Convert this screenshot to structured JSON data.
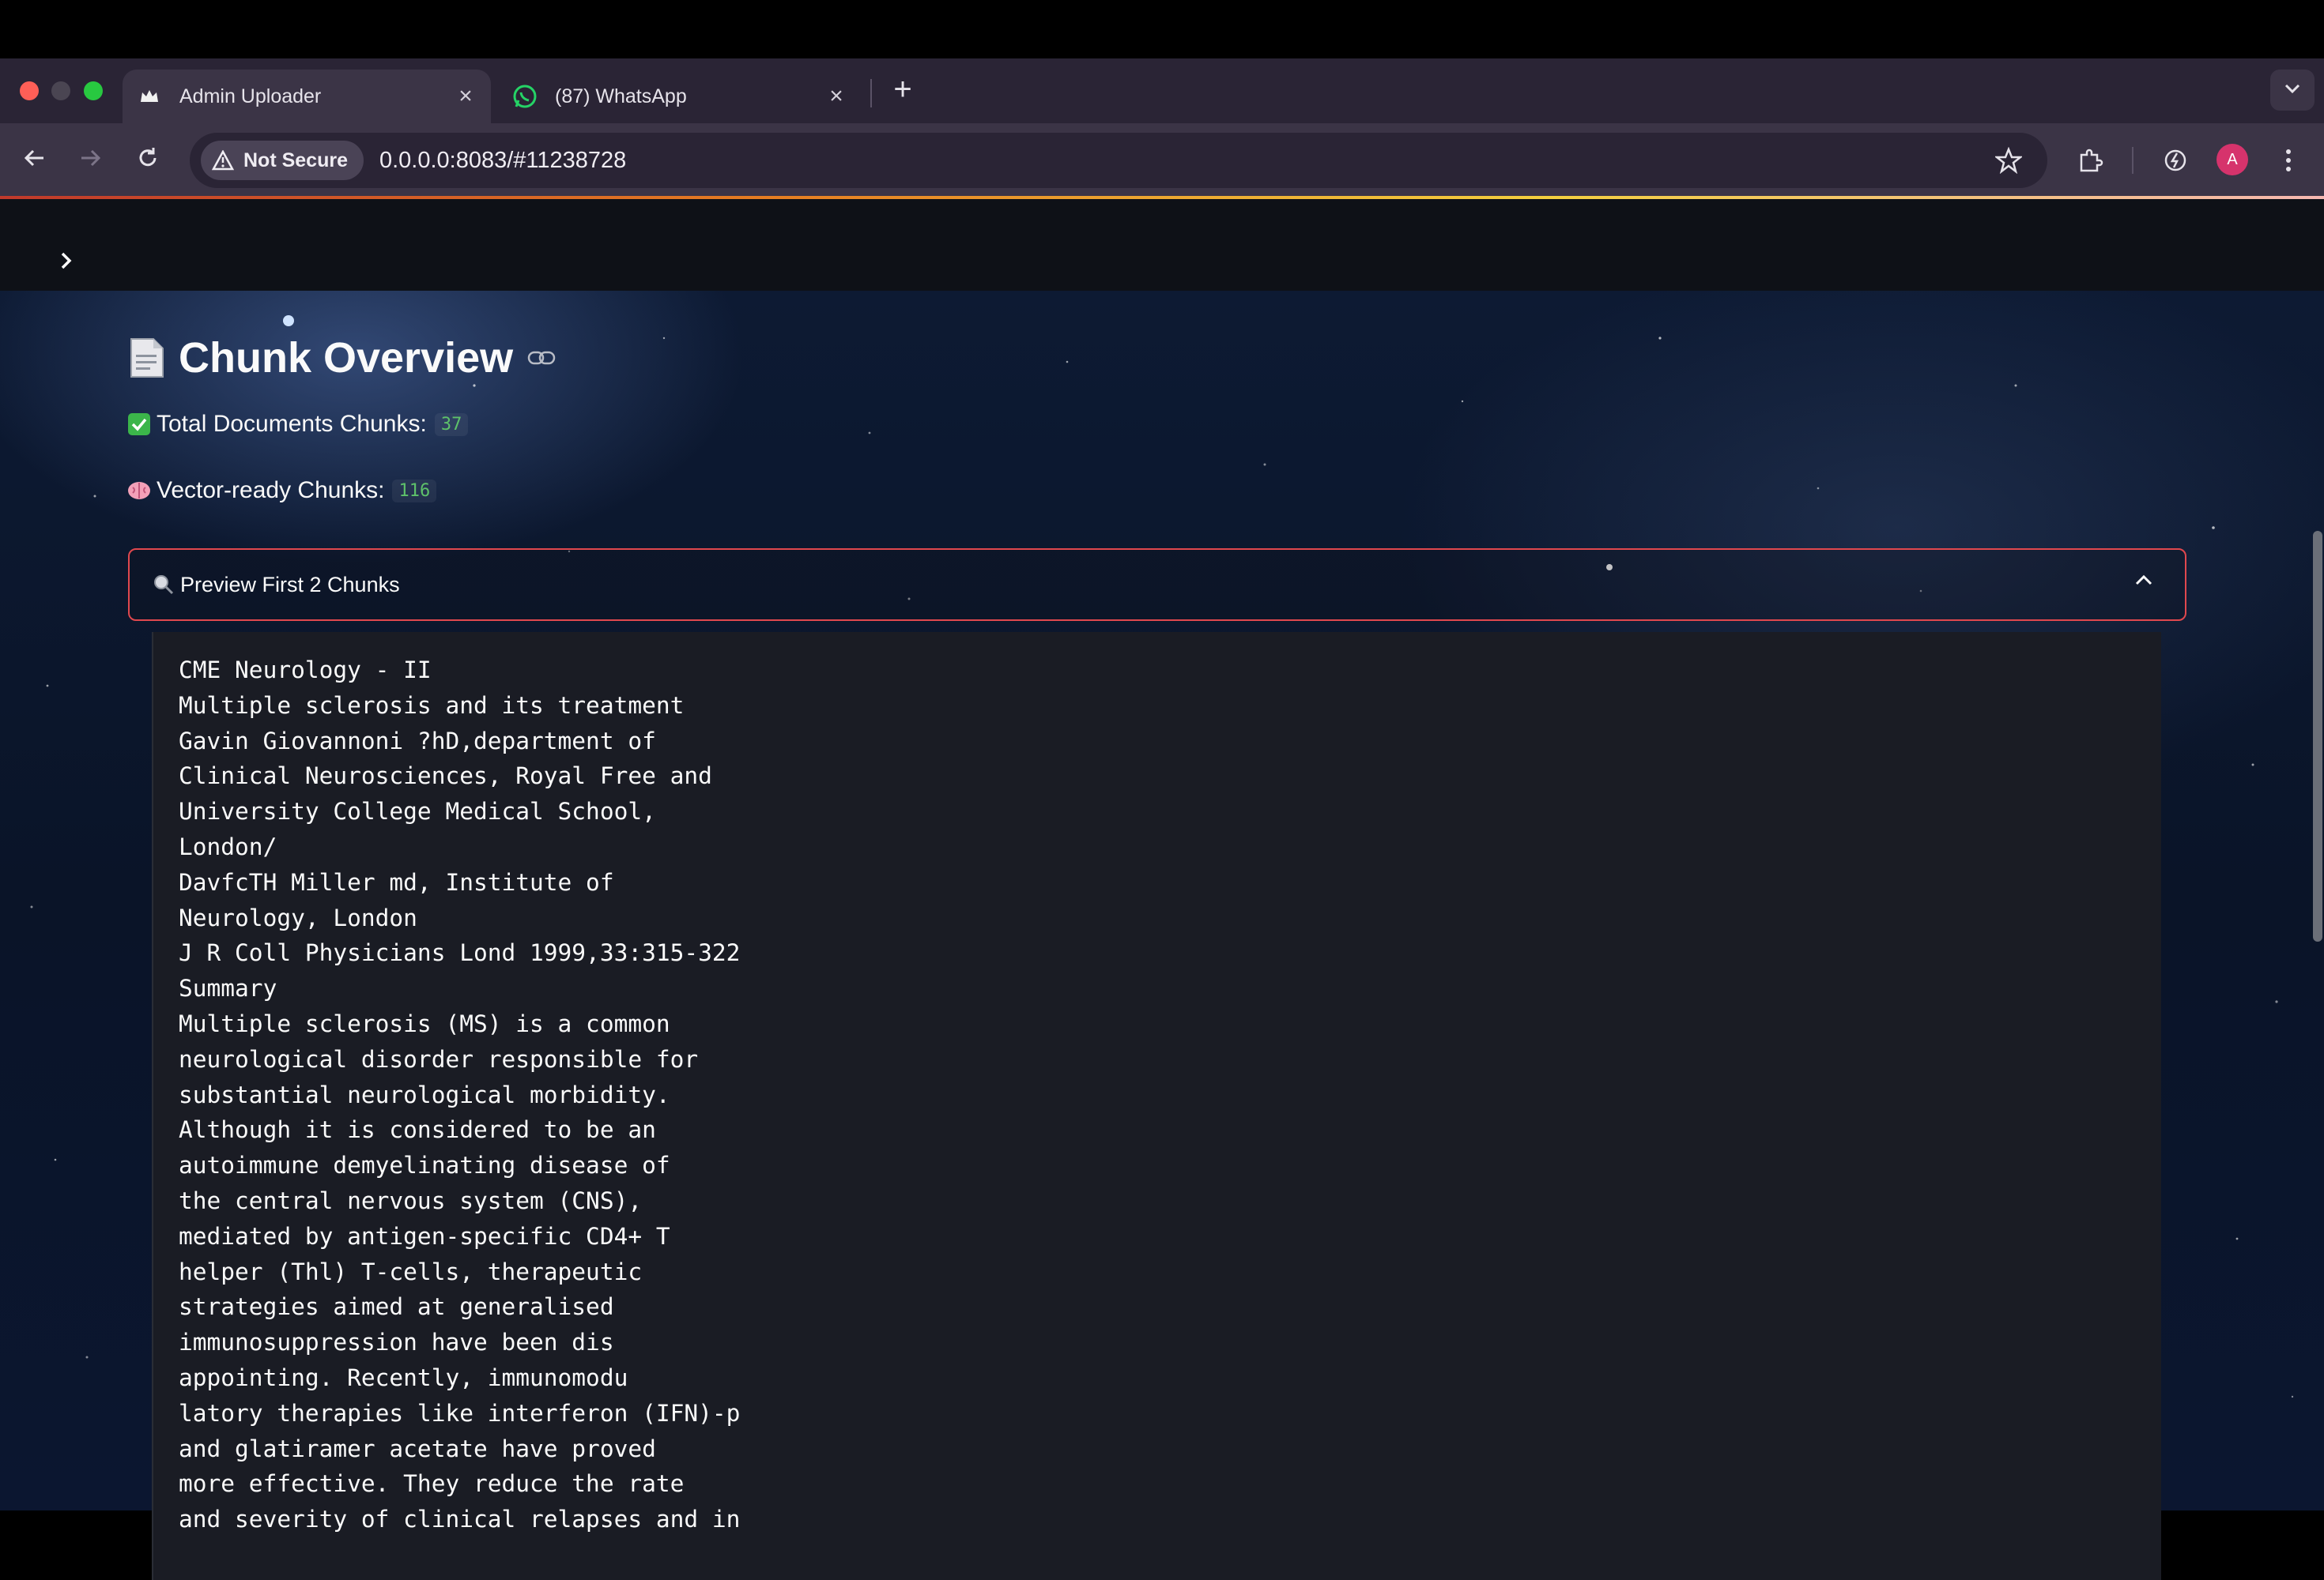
{
  "browser": {
    "tabs": [
      {
        "title": "Admin Uploader",
        "active": true,
        "favicon": "crown-icon"
      },
      {
        "title": "(87) WhatsApp",
        "active": false,
        "favicon": "whatsapp-icon"
      }
    ],
    "new_tab_label": "+",
    "security_label": "Not Secure",
    "url": "0.0.0.0:8083/#11238728",
    "profile_initial": "A"
  },
  "page": {
    "title": "Chunk Overview",
    "metrics": [
      {
        "label": "Total Documents Chunks:",
        "value": "37",
        "icon": "check-mark-icon"
      },
      {
        "label": "Vector-ready Chunks:",
        "value": "116",
        "icon": "brain-icon"
      }
    ],
    "expander": {
      "label": "Preview First 2 Chunks",
      "expanded": true
    },
    "chunk_text": "CME Neurology - II\nMultiple sclerosis and its treatment\nGavin Giovannoni ?hD,department of\nClinical Neurosciences, Royal Free and\nUniversity College Medical School,\nLondon/\nDavfcTH Miller md, Institute of\nNeurology, London\nJ R Coll Physicians Lond 1999,33:315-322\nSummary\nMultiple sclerosis (MS) is a common\nneurological disorder responsible for\nsubstantial neurological morbidity.\nAlthough it is considered to be an\nautoimmune demyelinating disease of\nthe central nervous system (CNS),\nmediated by antigen-specific CD4+ T\nhelper (Thl) T-cells, therapeutic\nstrategies aimed at generalised\nimmunosuppression have been dis\nappointing. Recently, immunomodu\nlatory therapies like interferon (IFN)-p\nand glatiramer acetate have proved\nmore effective. They reduce the rate\nand severity of clinical relapses and in"
  },
  "colors": {
    "accent_border": "#e0484e",
    "metric_value": "#5ec16a",
    "app_bg": "#0e1117"
  }
}
